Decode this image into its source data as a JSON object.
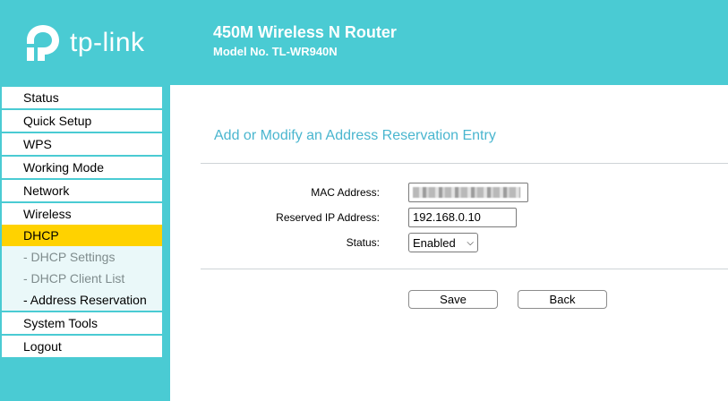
{
  "header": {
    "logo_text": "tp-link",
    "title": "450M Wireless N Router",
    "model": "Model No. TL-WR940N"
  },
  "sidebar": {
    "items": [
      {
        "label": "Status"
      },
      {
        "label": "Quick Setup"
      },
      {
        "label": "WPS"
      },
      {
        "label": "Working Mode"
      },
      {
        "label": "Network"
      },
      {
        "label": "Wireless"
      },
      {
        "label": "DHCP",
        "active": true
      }
    ],
    "sub_items": [
      {
        "label": "- DHCP Settings"
      },
      {
        "label": "- DHCP Client List"
      },
      {
        "label": "- Address Reservation",
        "current": true
      }
    ],
    "bottom_items": [
      {
        "label": "System Tools"
      },
      {
        "label": "Logout"
      }
    ]
  },
  "form": {
    "section_title": "Add or Modify an Address Reservation Entry",
    "mac_label": "MAC Address:",
    "ip_label": "Reserved IP Address:",
    "ip_value": "192.168.0.10",
    "status_label": "Status:",
    "status_value": "Enabled",
    "save_label": "Save",
    "back_label": "Back"
  },
  "colors": {
    "accent": "#4acbd3",
    "active_menu": "#ffd200",
    "title_text": "#4ab6cf"
  }
}
